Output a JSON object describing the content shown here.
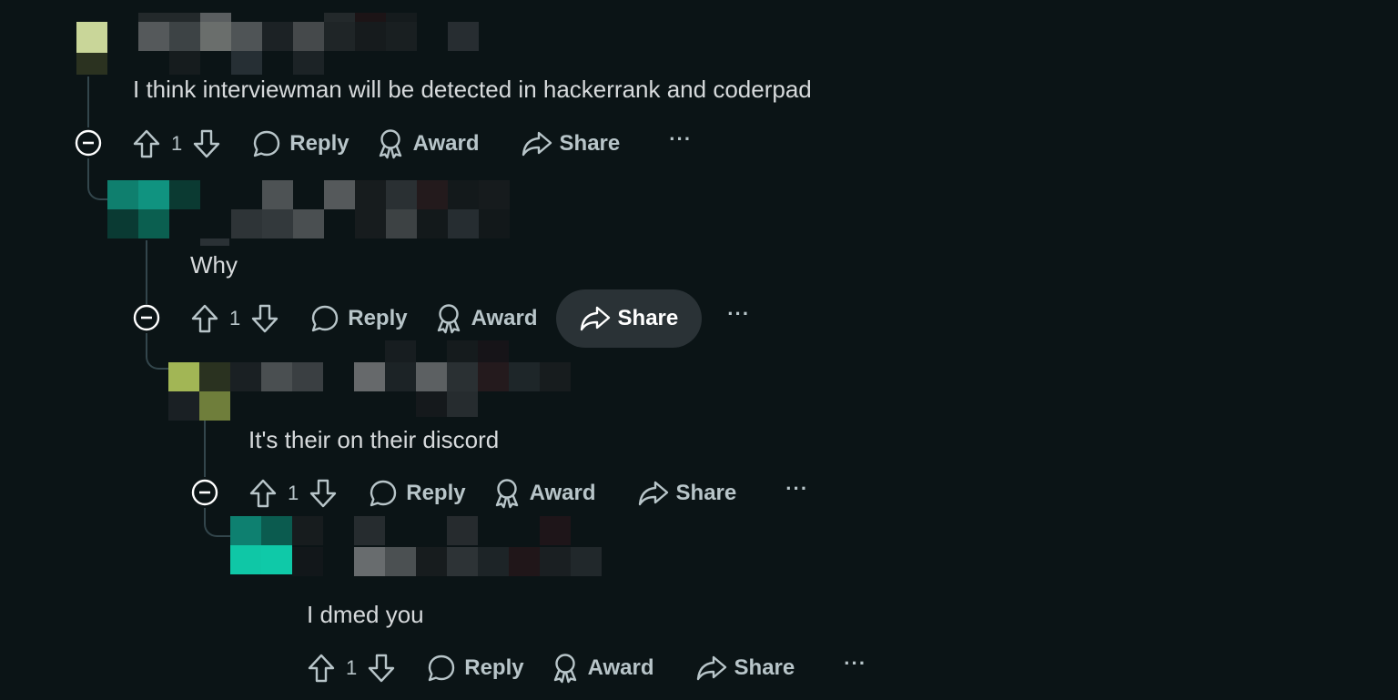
{
  "comments": [
    {
      "text": "I think interviewman will be detected in hackerrank and coderpad",
      "upvotes": "1",
      "reply_label": "Reply",
      "award_label": "Award",
      "share_label": "Share",
      "more_label": "···"
    },
    {
      "text": "Why",
      "upvotes": "1",
      "reply_label": "Reply",
      "award_label": "Award",
      "share_label": "Share",
      "more_label": "···"
    },
    {
      "text": "It's their on their discord",
      "upvotes": "1",
      "reply_label": "Reply",
      "award_label": "Award",
      "share_label": "Share",
      "more_label": "···"
    },
    {
      "text": "I dmed you",
      "upvotes": "1",
      "reply_label": "Reply",
      "award_label": "Award",
      "share_label": "Share",
      "more_label": "···"
    }
  ],
  "colors": {
    "background": "#0b1416",
    "share_hover_bg": "#2a3236",
    "thread_line": "#33464c"
  },
  "icons": [
    "upvote-icon",
    "downvote-icon",
    "reply-bubble-icon",
    "award-icon",
    "share-arrow-icon",
    "collapse-minus-icon",
    "more-dots-icon"
  ]
}
